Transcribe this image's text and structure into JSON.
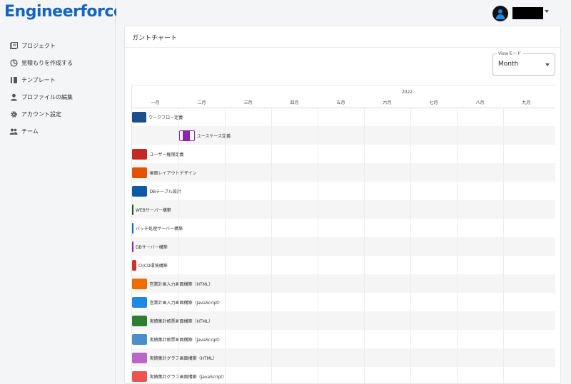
{
  "app": {
    "logo": "Engineerforce"
  },
  "sidebar": {
    "items": [
      {
        "label": "プロジェクト",
        "icon": "project-icon"
      },
      {
        "label": "見積もりを作成する",
        "icon": "estimate-icon"
      },
      {
        "label": "テンプレート",
        "icon": "template-icon"
      },
      {
        "label": "プロファイルの編集",
        "icon": "profile-icon"
      },
      {
        "label": "アカウント設定",
        "icon": "gear-icon"
      },
      {
        "label": "チーム",
        "icon": "team-icon"
      }
    ]
  },
  "header": {
    "username": ""
  },
  "card": {
    "title": "ガントチャート"
  },
  "viewmode": {
    "legend": "Viewモード",
    "value": "Month"
  },
  "gantt": {
    "year": "2022",
    "months": [
      "一月",
      "二月",
      "三月",
      "四月",
      "五月",
      "六月",
      "七月",
      "八月",
      "九月"
    ],
    "tasks": [
      {
        "label": "ワークフロー定義",
        "color": "#1f4e8c",
        "start_month": 0,
        "length_months": 0.31
      },
      {
        "label": "ユースケース定義",
        "color": "#8e24aa",
        "start_month": 1.02,
        "length_months": 0.33,
        "style": "outlined"
      },
      {
        "label": "ユーザー権限定義",
        "color": "#c62828",
        "start_month": 0,
        "length_months": 0.33
      },
      {
        "label": "画面レイアウトデザイン",
        "color": "#e65100",
        "start_month": 0,
        "length_months": 0.33
      },
      {
        "label": "DBテーブル設計",
        "color": "#0d5aa7",
        "start_month": 0,
        "length_months": 0.33
      },
      {
        "label": "WEBサーバー構築",
        "color": "#1b5e20",
        "start_month": 0,
        "length_months": 0.03
      },
      {
        "label": "バッチ処理サーバー構築",
        "color": "#1565c0",
        "start_month": 0,
        "length_months": 0.03
      },
      {
        "label": "DBサーバー構築",
        "color": "#8e24aa",
        "start_month": 0,
        "length_months": 0.03
      },
      {
        "label": "CI/CD環境構築",
        "color": "#d32f2f",
        "start_month": 0,
        "length_months": 0.09
      },
      {
        "label": "営業計画入力画面構築（HTML）",
        "color": "#ef6c00",
        "start_month": 0,
        "length_months": 0.33
      },
      {
        "label": "営業計画入力画面構築（JavaScript）",
        "color": "#1e88e5",
        "start_month": 0,
        "length_months": 0.33
      },
      {
        "label": "実績集計帳票画面構築（HTML）",
        "color": "#2e7d32",
        "start_month": 0,
        "length_months": 0.33
      },
      {
        "label": "実績集計帳票画面構築（JavaScript）",
        "color": "#4a8fcc",
        "start_month": 0,
        "length_months": 0.33
      },
      {
        "label": "実績集計グラフ画面構築（HTML）",
        "color": "#ba68c8",
        "start_month": 0,
        "length_months": 0.33
      },
      {
        "label": "実績集計グラフ画面構築（JavaScript）",
        "color": "#ef5350",
        "start_month": 0,
        "length_months": 0.33
      }
    ]
  }
}
